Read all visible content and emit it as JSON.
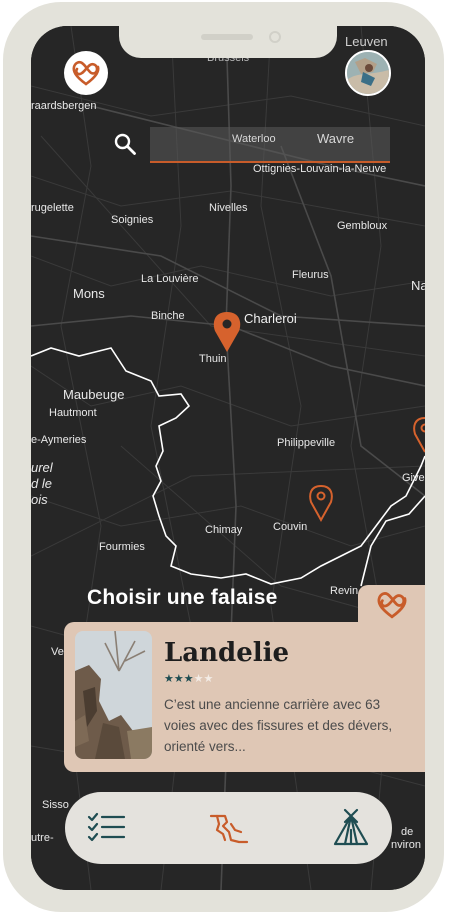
{
  "map": {
    "labels": {
      "brussels": "Brussels",
      "leuven": "Leuven",
      "geraardsbergen": "raardsbergen",
      "waterloo": "Waterloo",
      "wavre": "Wavre",
      "ottignies": "Ottignies-Louvain-la-Neuve",
      "brugelette": "rugelette",
      "soignies": "Soignies",
      "nivelles": "Nivelles",
      "gembloux": "Gembloux",
      "la_louviere": "La Louvière",
      "fleurus": "Fleurus",
      "mons": "Mons",
      "na": "Na",
      "binche": "Binche",
      "charleroi": "Charleroi",
      "thuin": "Thuin",
      "maubeuge": "Maubeuge",
      "hautmont": "Hautmont",
      "aymeries": "e-Aymeries",
      "philippeville": "Philippeville",
      "givet": "Give",
      "aurel": "urel\nd le\nois",
      "chimay": "Chimay",
      "couvin": "Couvin",
      "fourmies": "Fourmies",
      "revin": "Revin",
      "ve": "Ve",
      "sisso": "Sisso",
      "outre": "utre-",
      "de": "de",
      "environs": "nviron"
    }
  },
  "header": {
    "logo_icon": "heart-knot-logo-icon",
    "avatar_icon": "climber-avatar"
  },
  "search": {
    "placeholder": "",
    "icon": "search-icon"
  },
  "section": {
    "title": "Choisir une falaise"
  },
  "card": {
    "title": "Landelie",
    "rating": 3,
    "rating_max": 5,
    "description": "C’est une ancienne carrière avec 63 voies avec des fissures et des dévers, orienté vers...",
    "favorite_icon": "heart-knot-icon"
  },
  "tabbar": {
    "tabs": [
      {
        "name": "list",
        "icon": "checklist-icon"
      },
      {
        "name": "cliff",
        "icon": "cliff-icon",
        "active": true
      },
      {
        "name": "camping",
        "icon": "tent-icon"
      }
    ]
  },
  "colors": {
    "accent": "#c85c2a",
    "card_bg": "#dfc7b5",
    "teal": "#1f4d52",
    "map_bg": "#262626",
    "frame": "#e3e2da"
  }
}
